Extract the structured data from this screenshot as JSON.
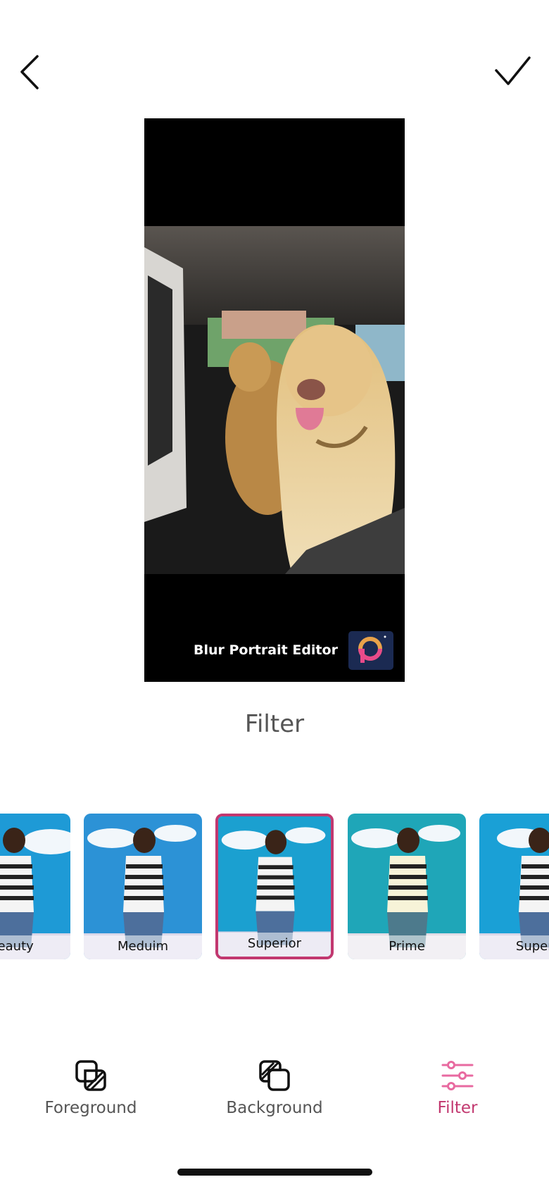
{
  "header": {
    "back_icon": "chevron-left-icon",
    "done_icon": "checkmark-icon"
  },
  "preview": {
    "watermark_text": "Blur Portrait Editor",
    "watermark_logo": "app-logo-icon",
    "logo_color": "#1b2a52"
  },
  "section": {
    "title": "Filter"
  },
  "filters": [
    {
      "label": "Beauty",
      "selected": false
    },
    {
      "label": "Meduim",
      "selected": false
    },
    {
      "label": "Superior",
      "selected": true
    },
    {
      "label": "Prime",
      "selected": false
    },
    {
      "label": "Superb",
      "selected": false
    }
  ],
  "bottom_nav": {
    "items": [
      {
        "label": "Foreground",
        "icon": "foreground-layers-icon",
        "active": false
      },
      {
        "label": "Background",
        "icon": "background-layers-icon",
        "active": false
      },
      {
        "label": "Filter",
        "icon": "sliders-icon",
        "active": true
      }
    ]
  },
  "colors": {
    "accent": "#c2386f",
    "text_muted": "#555555"
  }
}
